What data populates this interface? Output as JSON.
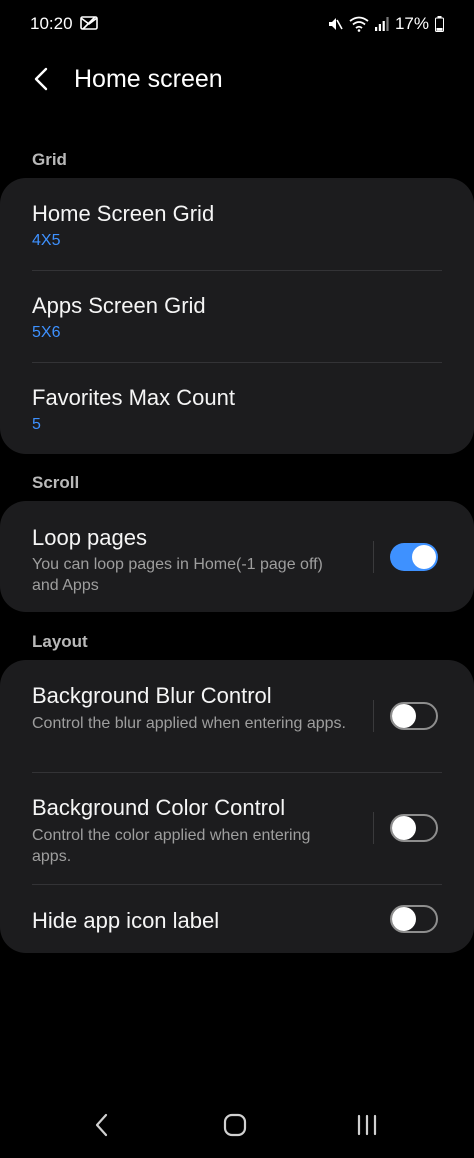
{
  "status": {
    "time": "10:20",
    "battery": "17%"
  },
  "header": {
    "title": "Home screen"
  },
  "sections": {
    "grid": {
      "label": "Grid",
      "items": [
        {
          "title": "Home Screen Grid",
          "value": "4X5"
        },
        {
          "title": "Apps Screen Grid",
          "value": "5X6"
        },
        {
          "title": "Favorites Max Count",
          "value": "5"
        }
      ]
    },
    "scroll": {
      "label": "Scroll",
      "items": [
        {
          "title": "Loop pages",
          "subtitle": "You can loop pages in Home(-1 page off) and Apps",
          "toggle": true
        }
      ]
    },
    "layout": {
      "label": "Layout",
      "items": [
        {
          "title": "Background Blur Control",
          "subtitle": "Control the blur applied when entering apps.",
          "toggle": false
        },
        {
          "title": "Background Color Control",
          "subtitle": "Control the color applied when entering apps.",
          "toggle": false
        },
        {
          "title": "Hide app icon label",
          "toggle": false
        }
      ]
    }
  },
  "colors": {
    "accent": "#3e91ff",
    "card": "#1c1c1e",
    "background": "#000000"
  },
  "icons": [
    "vibrate-off-icon",
    "mute-icon",
    "wifi-icon",
    "signal-icon",
    "battery-icon",
    "back-arrow-icon",
    "nav-back-icon",
    "nav-home-icon",
    "nav-recents-icon"
  ]
}
